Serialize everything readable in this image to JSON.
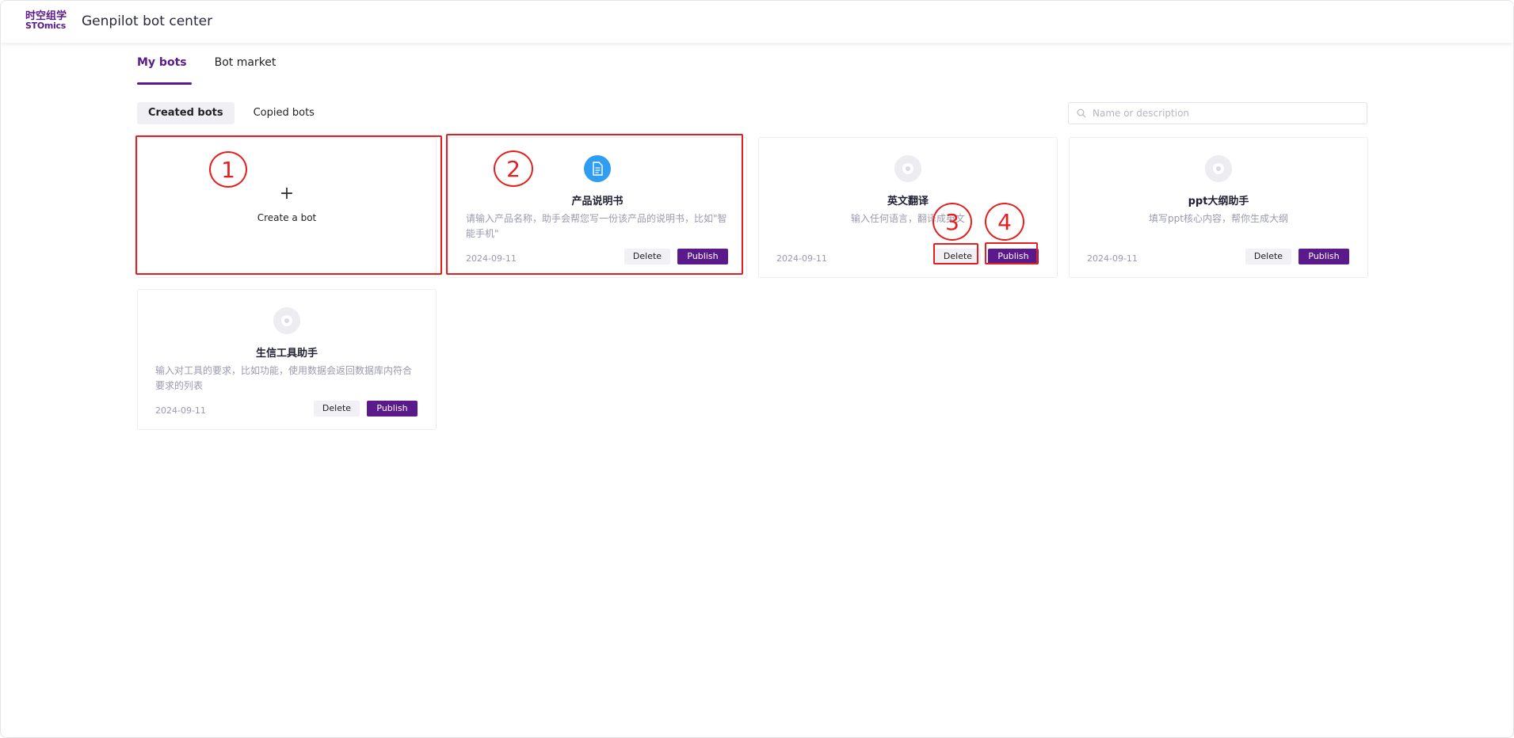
{
  "header": {
    "logo_line1": "时空组学",
    "logo_line2": "STOmics",
    "title": "Genpilot bot center"
  },
  "main_tabs": [
    {
      "label": "My bots",
      "active": true
    },
    {
      "label": "Bot market",
      "active": false
    }
  ],
  "sub_tabs": [
    {
      "label": "Created bots",
      "active": true
    },
    {
      "label": "Copied bots",
      "active": false
    }
  ],
  "search": {
    "placeholder": "Name or description",
    "value": ""
  },
  "create_card": {
    "plus": "+",
    "label": "Create a bot"
  },
  "bots": [
    {
      "name": "产品说明书",
      "description": "请输入产品名称，助手会帮您写一份该产品的说明书，比如\"智能手机\"",
      "date": "2024-09-11",
      "icon": "document-icon",
      "delete_label": "Delete",
      "publish_label": "Publish"
    },
    {
      "name": "英文翻译",
      "description": "输入任何语言，翻译成英文",
      "date": "2024-09-11",
      "icon": "bot-default-icon",
      "delete_label": "Delete",
      "publish_label": "Publish"
    },
    {
      "name": "ppt大纲助手",
      "description": "填写ppt核心内容，帮你生成大纲",
      "date": "2024-09-11",
      "icon": "bot-default-icon",
      "delete_label": "Delete",
      "publish_label": "Publish"
    },
    {
      "name": "生信工具助手",
      "description": "输入对工具的要求，比如功能，使用数据会返回数据库内符合要求的列表",
      "date": "2024-09-11",
      "icon": "bot-default-icon",
      "delete_label": "Delete",
      "publish_label": "Publish"
    }
  ],
  "annotations": [
    "1",
    "2",
    "3",
    "4"
  ],
  "colors": {
    "brand": "#5b1a8b",
    "annotation": "#e51f1f",
    "icon_blue": "#2f9df0"
  }
}
